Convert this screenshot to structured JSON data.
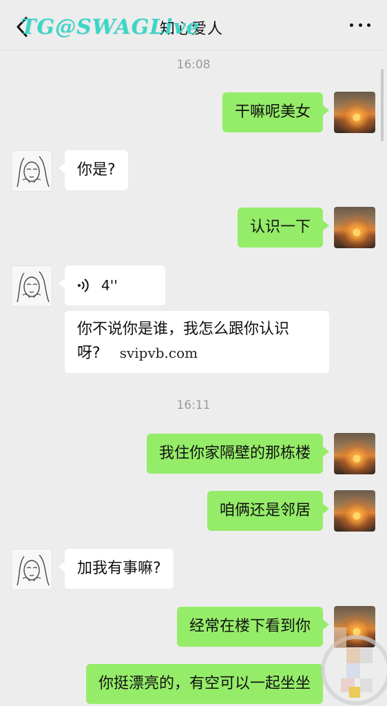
{
  "header": {
    "title": "知心爱人",
    "watermark": "TG@SWAGLive"
  },
  "timestamps": [
    "16:08",
    "16:11"
  ],
  "messages": [
    {
      "side": "me",
      "text": "干嘛呢美女"
    },
    {
      "side": "them",
      "text": "你是?"
    },
    {
      "side": "me",
      "text": "认识一下"
    },
    {
      "side": "them",
      "type": "voice",
      "duration": "4''"
    },
    {
      "side": "them",
      "text_line1": "你不说你是谁，我怎么跟你认识",
      "text_line2": "呀?",
      "overlay": "svipvb.com"
    },
    {
      "side": "me",
      "text": "我住你家隔壁的那栋楼"
    },
    {
      "side": "me",
      "text": "咱俩还是邻居"
    },
    {
      "side": "them",
      "text": "加我有事嘛?"
    },
    {
      "side": "me",
      "text": "经常在楼下看到你"
    },
    {
      "side": "me",
      "text": "你挺漂亮的，有空可以一起坐坐"
    }
  ],
  "colors": {
    "my_bubble": "#95ec69",
    "their_bubble": "#ffffff",
    "background": "#ededed",
    "watermark": "#3ad6c7"
  },
  "icons": {
    "back": "chevron-left-icon",
    "more": "more-dots-icon",
    "voice": "voice-wave-icon"
  }
}
